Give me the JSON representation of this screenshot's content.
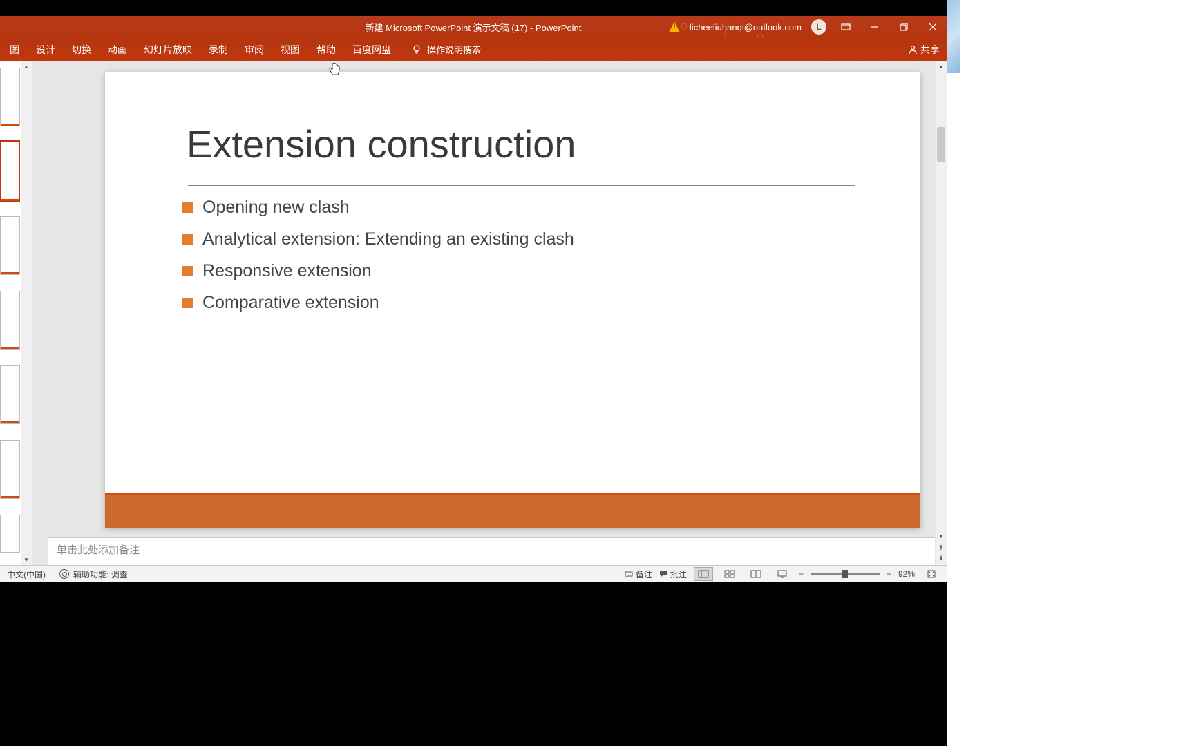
{
  "title": "新建 Microsoft PowerPoint 演示文稿 (17)  -  PowerPoint",
  "user": {
    "email": "licheeliuhanqi@outlook.com",
    "initial": "L"
  },
  "tabs": [
    "图",
    "设计",
    "切换",
    "动画",
    "幻灯片放映",
    "录制",
    "审阅",
    "视图",
    "帮助",
    "百度网盘"
  ],
  "tell_me": "操作说明搜索",
  "share": "共享",
  "slide": {
    "title": "Extension construction",
    "bullets": [
      "Opening new clash",
      "Analytical extension: Extending an existing clash",
      "Responsive extension",
      "Comparative extension"
    ]
  },
  "notes_placeholder": "单击此处添加备注",
  "status": {
    "language": "中文(中国)",
    "accessibility": "辅助功能: 调查",
    "notes_btn": "备注",
    "comments_btn": "批注",
    "zoom": "92%"
  }
}
